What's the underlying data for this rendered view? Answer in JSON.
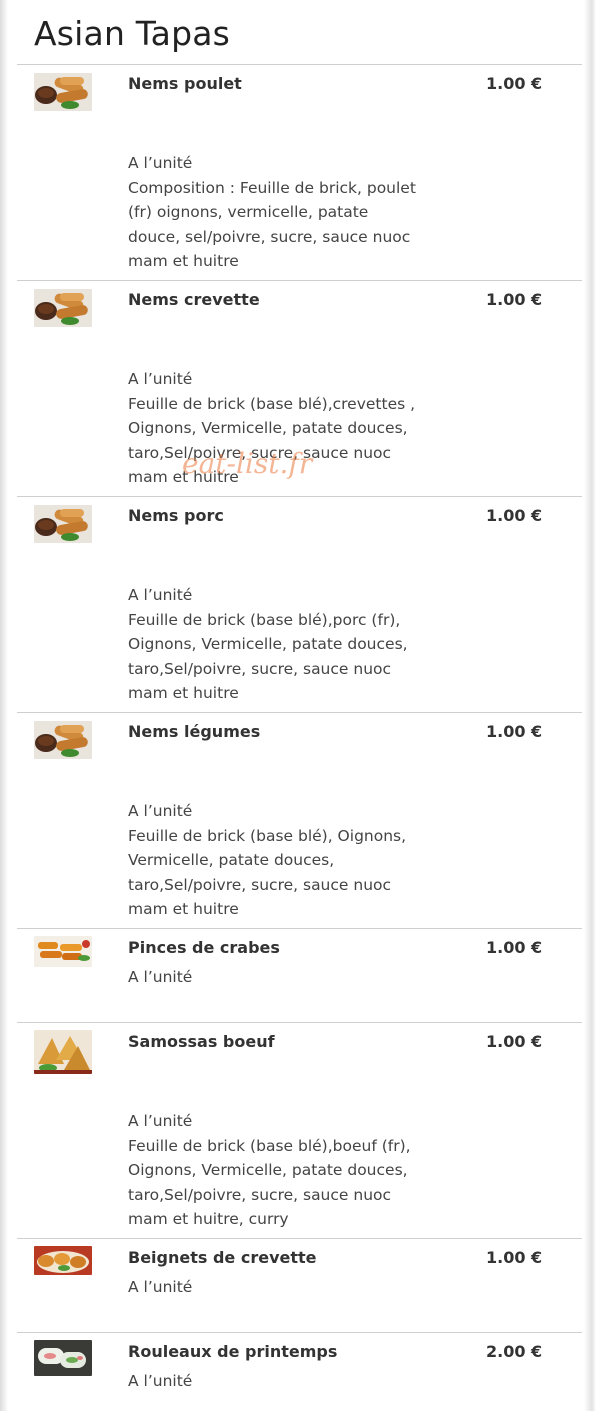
{
  "page": {
    "title": "Asian Tapas",
    "watermark": "eat-list.fr"
  },
  "items": [
    {
      "name": "Nems poulet",
      "price": "1.00 €",
      "image": "nems-image",
      "desc_lines": [
        "A l’unité",
        "Composition : Feuille de brick, poulet",
        "(fr) oignons, vermicelle, patate",
        "douce, sel/poivre, sucre, sauce nuoc",
        "mam et huitre"
      ]
    },
    {
      "name": "Nems crevette",
      "price": "1.00 €",
      "image": "nems-image",
      "desc_lines": [
        "A l’unité",
        "Feuille de brick (base blé),crevettes ,",
        "Oignons, Vermicelle, patate douces,",
        "taro,Sel/poivre, sucre, sauce nuoc",
        "mam et huitre"
      ]
    },
    {
      "name": "Nems porc",
      "price": "1.00 €",
      "image": "nems-image",
      "desc_lines": [
        "A l’unité",
        "Feuille de brick (base blé),porc (fr),",
        "Oignons, Vermicelle, patate douces,",
        "taro,Sel/poivre, sucre, sauce nuoc",
        "mam et huitre"
      ]
    },
    {
      "name": "Nems légumes",
      "price": "1.00 €",
      "image": "nems-image",
      "desc_lines": [
        "A l’unité",
        "Feuille de brick (base blé), Oignons,",
        "Vermicelle, patate douces,",
        "taro,Sel/poivre, sucre, sauce nuoc",
        "mam et huitre"
      ]
    },
    {
      "name": "Pinces de crabes",
      "price": "1.00 €",
      "image": "crab-claws-image",
      "desc_lines": [
        "A l’unité"
      ]
    },
    {
      "name": "Samossas boeuf",
      "price": "1.00 €",
      "image": "samossas-image",
      "desc_lines": [
        "A l’unité",
        "Feuille de brick (base blé),boeuf (fr),",
        "Oignons, Vermicelle, patate douces,",
        "taro,Sel/poivre, sucre, sauce nuoc",
        "mam et huitre, curry"
      ]
    },
    {
      "name": "Beignets de crevette",
      "price": "1.00 €",
      "image": "shrimp-fritters-image",
      "desc_lines": [
        "A l’unité"
      ]
    },
    {
      "name": "Rouleaux de printemps",
      "price": "2.00 €",
      "image": "spring-rolls-image",
      "desc_lines": [
        "A l’unité"
      ]
    }
  ]
}
